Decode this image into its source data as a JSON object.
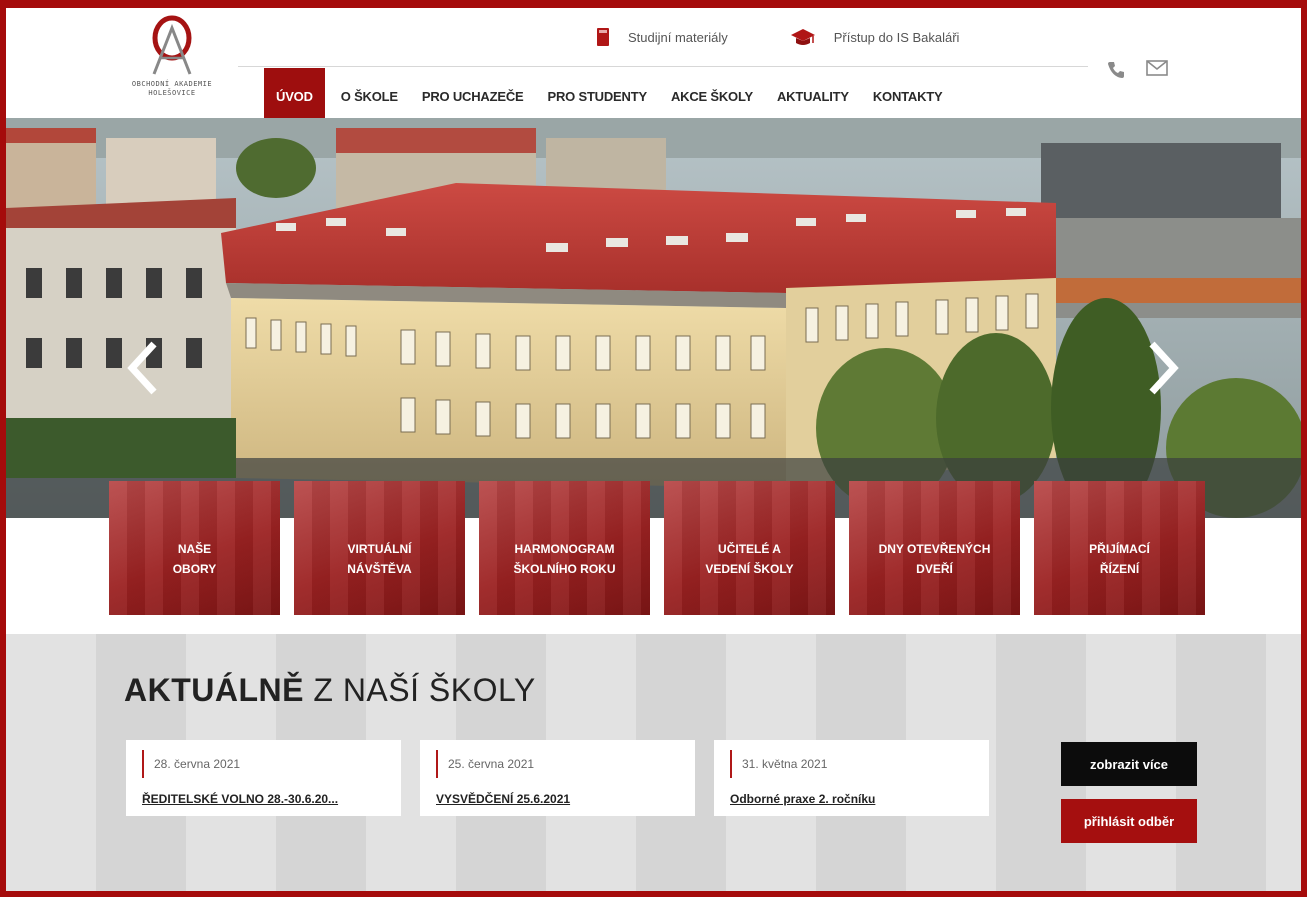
{
  "header": {
    "logo_text_line1": "OBCHODNÍ AKADEMIE",
    "logo_text_line2": "HOLEŠOVICE",
    "top_links": [
      {
        "label": "Studijní materiály",
        "icon": "book-icon"
      },
      {
        "label": "Přístup do IS Bakaláři",
        "icon": "graduation-cap-icon"
      }
    ],
    "contact_icons": [
      "phone-icon",
      "envelope-icon"
    ]
  },
  "nav": {
    "items": [
      {
        "label": "ÚVOD",
        "active": true
      },
      {
        "label": "O ŠKOLE",
        "active": false
      },
      {
        "label": "PRO UCHAZEČE",
        "active": false
      },
      {
        "label": "PRO STUDENTY",
        "active": false
      },
      {
        "label": "AKCE ŠKOLY",
        "active": false
      },
      {
        "label": "AKTUALITY",
        "active": false
      },
      {
        "label": "KONTAKTY",
        "active": false
      }
    ]
  },
  "tiles": [
    {
      "line1": "NAŠE",
      "line2": "OBORY"
    },
    {
      "line1": "VIRTUÁLNÍ",
      "line2": "NÁVŠTĚVA"
    },
    {
      "line1": "HARMONOGRAM",
      "line2": "ŠKOLNÍHO ROKU"
    },
    {
      "line1": "UČITELÉ A",
      "line2": "VEDENÍ ŠKOLY"
    },
    {
      "line1": "DNY OTEVŘENÝCH",
      "line2": "DVEŘÍ"
    },
    {
      "line1": "PŘIJÍMACÍ",
      "line2": "ŘÍZENÍ"
    }
  ],
  "news": {
    "title_bold": "AKTUÁLNĚ",
    "title_light": " Z NAŠÍ ŠKOLY",
    "cards": [
      {
        "date": "28. června 2021",
        "title": "ŘEDITELSKÉ VOLNO 28.-30.6.20..."
      },
      {
        "date": "25. června 2021",
        "title": "VYSVĚDČENÍ 25.6.2021"
      },
      {
        "date": "31. května 2021",
        "title": "Odborné praxe 2. ročníku"
      }
    ],
    "more_button": "zobrazit více",
    "subscribe_button": "přihlásit odběr"
  },
  "colors": {
    "accent": "#9e0e0e",
    "frame": "#a50b0b"
  }
}
